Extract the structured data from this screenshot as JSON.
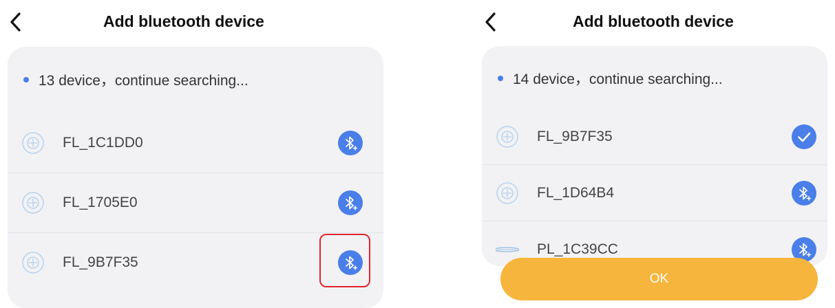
{
  "screens": [
    {
      "title": "Add bluetooth device",
      "status": "13 device，continue searching...",
      "devices": [
        {
          "name": "FL_1C1DD0",
          "action": "bluetooth-add-icon"
        },
        {
          "name": "FL_1705E0",
          "action": "bluetooth-add-icon"
        },
        {
          "name": "FL_9B7F35",
          "action": "bluetooth-add-icon"
        }
      ]
    },
    {
      "title": "Add bluetooth device",
      "status": "14 device，continue searching...",
      "devices": [
        {
          "name": "FL_9B7F35",
          "action": "checkmark-icon"
        },
        {
          "name": "FL_1D64B4",
          "action": "bluetooth-add-icon"
        },
        {
          "name": "PL_1C39CC",
          "action": "bluetooth-add-icon"
        }
      ],
      "ok_label": "OK"
    }
  ],
  "colors": {
    "accent": "#4a7ee8",
    "ok_button": "#f6b53d",
    "highlight": "#e0252c",
    "card": "#f2f2f4"
  }
}
